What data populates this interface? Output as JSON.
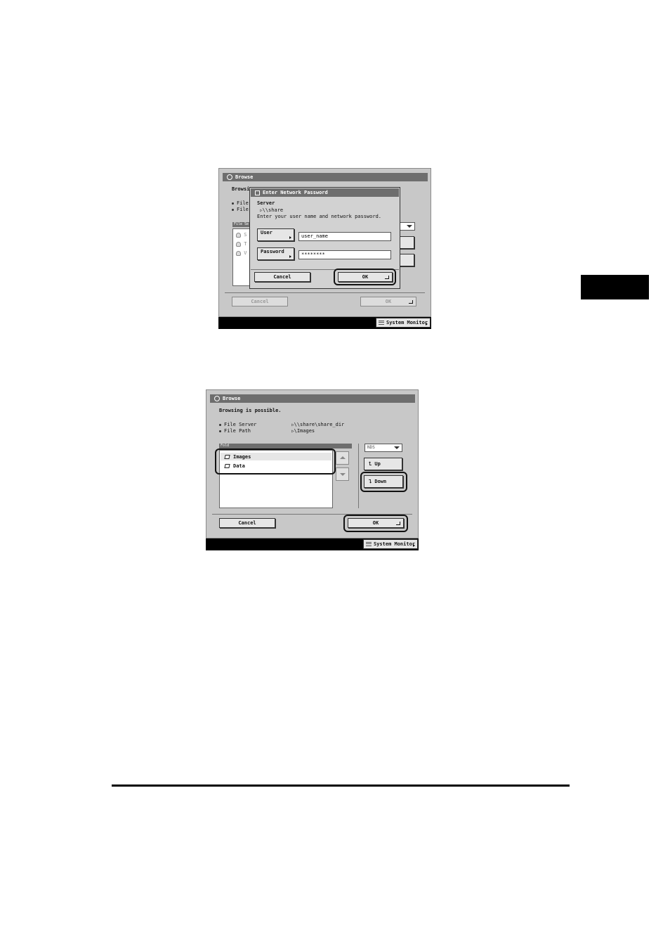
{
  "side_tab": {
    "color": "#000000"
  },
  "screen1": {
    "title": "Browse",
    "browsing_text_partial": "Browsin",
    "file_server_partial": "File S",
    "file_path_partial": "File F",
    "list_header_partial": "File Serv",
    "list_items_partial": [
      "S",
      "T",
      "V"
    ],
    "cancel_label": "Cancel",
    "ok_label": "OK",
    "system_monitor_label": "System Monitor",
    "dialog": {
      "title": "Enter Network Password",
      "server_label": "Server",
      "server_value": "\\\\share",
      "instruction": "Enter your user name and network password.",
      "user_button_label": "User",
      "user_value": "user_name",
      "password_button_label": "Password",
      "password_value": "********",
      "cancel_label": "Cancel",
      "ok_label": "OK"
    }
  },
  "screen2": {
    "title": "Browse",
    "status_text": "Browsing is possible.",
    "file_server_label": "File Server",
    "file_server_value": "\\\\share\\share_dir",
    "file_path_label": "File Path",
    "file_path_value": "\\Images",
    "list_header": "Fold",
    "folders": [
      "Images",
      "Data"
    ],
    "protocol_dropdown": "NDS",
    "up_label": "Up",
    "down_label": "Down",
    "cancel_label": "Cancel",
    "ok_label": "OK",
    "system_monitor_label": "System Monitor"
  }
}
